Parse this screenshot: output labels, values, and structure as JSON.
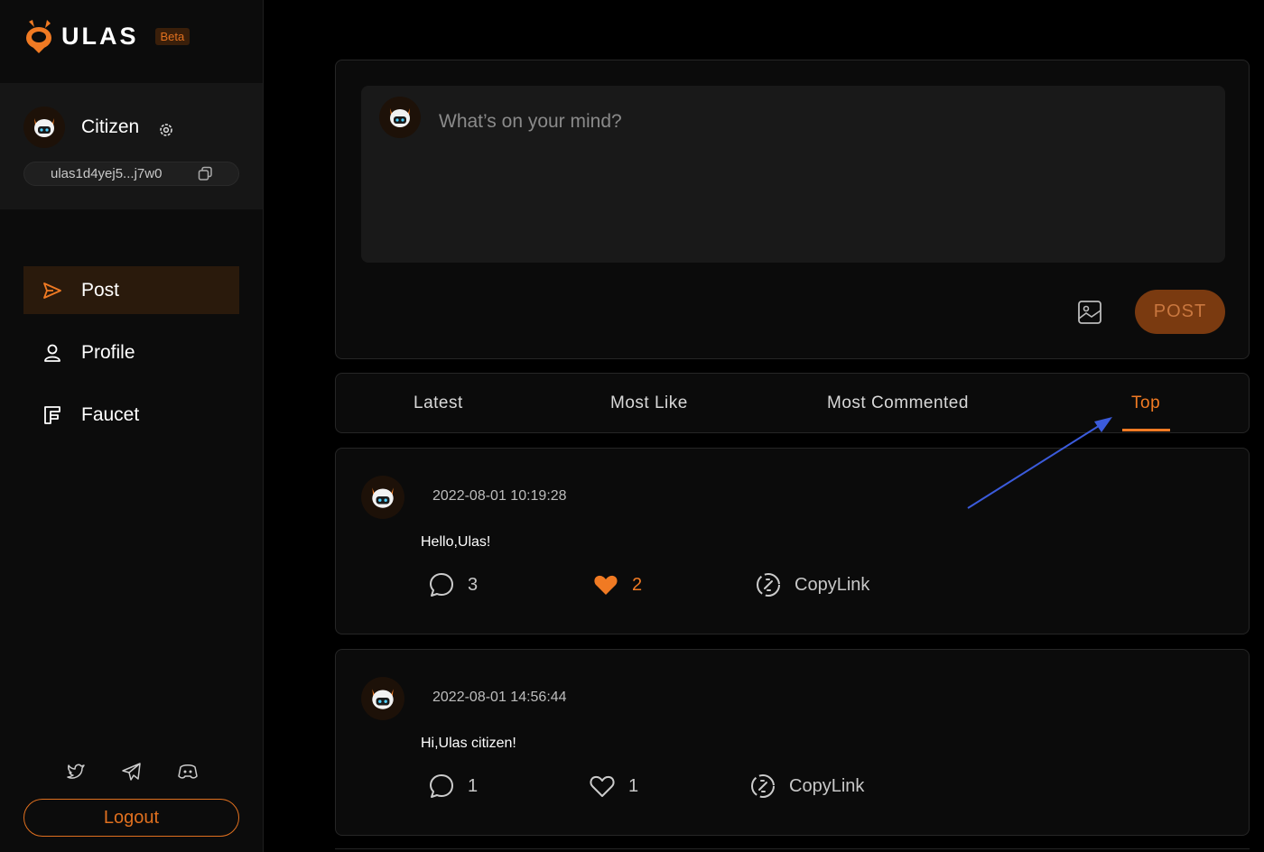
{
  "brand": {
    "name": "ULAS",
    "badge": "Beta"
  },
  "user": {
    "name": "Citizen",
    "address": "ulas1d4yej5...j7w0"
  },
  "nav": {
    "items": [
      {
        "label": "Post",
        "icon": "send-icon",
        "active": true
      },
      {
        "label": "Profile",
        "icon": "user-icon",
        "active": false
      },
      {
        "label": "Faucet",
        "icon": "faucet-icon",
        "active": false
      }
    ]
  },
  "socials": [
    "twitter-icon",
    "telegram-icon",
    "discord-icon"
  ],
  "logout_label": "Logout",
  "composer": {
    "placeholder": "What’s on your mind?",
    "post_label": "POST"
  },
  "tabs": [
    {
      "label": "Latest",
      "active": false
    },
    {
      "label": "Most Like",
      "active": false
    },
    {
      "label": "Most Commented",
      "active": false
    },
    {
      "label": "Top",
      "active": true
    }
  ],
  "posts": [
    {
      "time": "2022-08-01 10:19:28",
      "text": "Hello,Ulas!",
      "comments": "3",
      "likes": "2",
      "liked": true,
      "copy_label": "CopyLink"
    },
    {
      "time": "2022-08-01 14:56:44",
      "text": "Hi,Ulas citizen!",
      "comments": "1",
      "likes": "1",
      "liked": false,
      "copy_label": "CopyLink"
    }
  ],
  "colors": {
    "accent": "#f07a23",
    "background": "#000000",
    "panel": "#0b0b0b",
    "annotation_arrow": "#3b5bdb"
  }
}
